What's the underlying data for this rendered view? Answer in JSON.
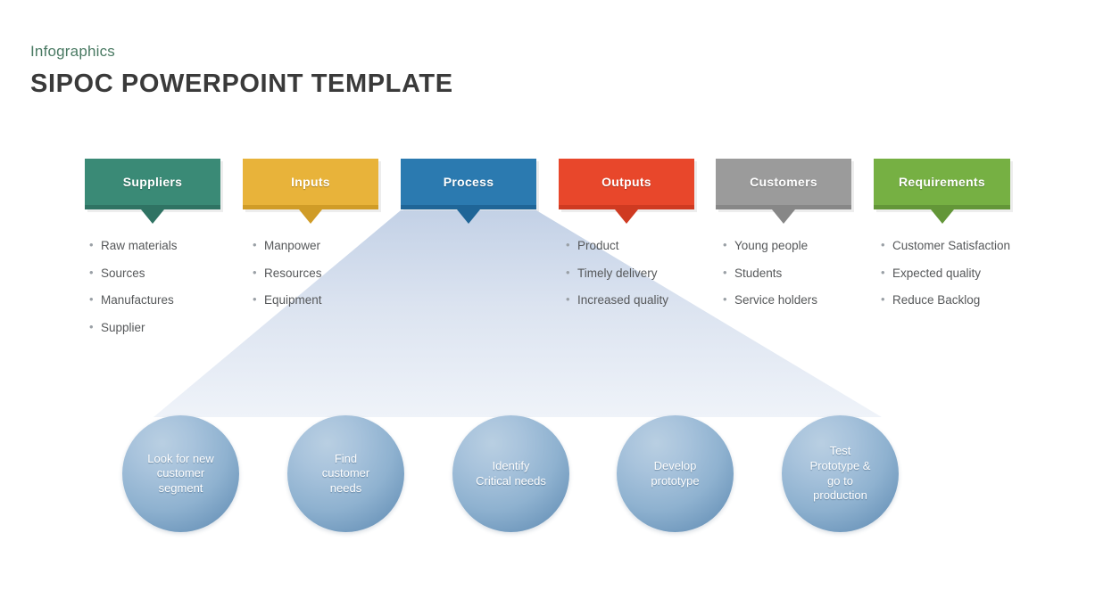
{
  "header": {
    "kicker": "Infographics",
    "title": "SIPOC POWERPOINT TEMPLATE",
    "kicker_color": "#4a7a63",
    "title_color": "#3a3a3a"
  },
  "columns": [
    {
      "key": "suppliers",
      "label": "Suppliers",
      "color": "#3a8a76",
      "strip_color": "#2f7363",
      "items": [
        "Raw materials",
        "Sources",
        "Manufactures",
        "Supplier"
      ]
    },
    {
      "key": "inputs",
      "label": "Inputs",
      "color": "#e8b33a",
      "strip_color": "#d09c27",
      "items": [
        "Manpower",
        "Resources",
        "Equipment"
      ]
    },
    {
      "key": "process",
      "label": "Process",
      "color": "#2b7ab0",
      "strip_color": "#1f6597",
      "items": []
    },
    {
      "key": "outputs",
      "label": "Outputs",
      "color": "#e8472b",
      "strip_color": "#cf3a21",
      "items": [
        "Product",
        "Timely delivery",
        "Increased quality"
      ]
    },
    {
      "key": "customers",
      "label": "Customers",
      "color": "#9b9b9b",
      "strip_color": "#878787",
      "items": [
        "Young people",
        "Students",
        "Service holders"
      ]
    },
    {
      "key": "requirements",
      "label": "Requirements",
      "color": "#76b043",
      "strip_color": "#639638",
      "items": [
        "Customer Satisfaction",
        "Expected quality",
        "Reduce Backlog"
      ]
    }
  ],
  "bullet_glyph": "•",
  "funnel": {
    "fill_top": "#c3d1e6",
    "fill_bottom": "#eef2f9"
  },
  "steps": [
    {
      "lines": [
        "Look for new",
        "customer",
        "segment"
      ]
    },
    {
      "lines": [
        "Find",
        "customer",
        "needs"
      ]
    },
    {
      "lines": [
        "Identify",
        "Critical needs"
      ]
    },
    {
      "lines": [
        "Develop",
        "prototype"
      ]
    },
    {
      "lines": [
        "Test",
        "Prototype &",
        "go to",
        "production"
      ]
    }
  ]
}
